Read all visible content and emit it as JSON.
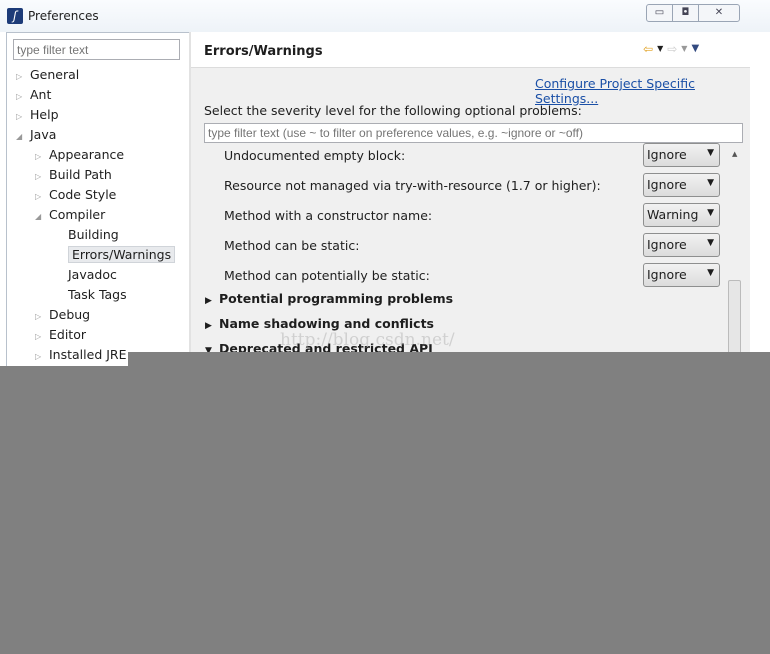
{
  "window": {
    "title": "Preferences",
    "app_icon": "eclipse-icon",
    "controls": [
      "minimize",
      "maximize",
      "close"
    ]
  },
  "sidebar": {
    "filter_placeholder": "type filter text",
    "items": [
      {
        "label": "General",
        "level": 0,
        "state": "collapsed"
      },
      {
        "label": "Ant",
        "level": 0,
        "state": "collapsed"
      },
      {
        "label": "Help",
        "level": 0,
        "state": "collapsed"
      },
      {
        "label": "Java",
        "level": 0,
        "state": "expanded"
      },
      {
        "label": "Appearance",
        "level": 1,
        "state": "collapsed"
      },
      {
        "label": "Build Path",
        "level": 1,
        "state": "collapsed"
      },
      {
        "label": "Code Style",
        "level": 1,
        "state": "collapsed"
      },
      {
        "label": "Compiler",
        "level": 1,
        "state": "expanded"
      },
      {
        "label": "Building",
        "level": 2,
        "state": "leaf"
      },
      {
        "label": "Errors/Warnings",
        "level": 2,
        "state": "leaf",
        "selected": true
      },
      {
        "label": "Javadoc",
        "level": 2,
        "state": "leaf"
      },
      {
        "label": "Task Tags",
        "level": 2,
        "state": "leaf"
      },
      {
        "label": "Debug",
        "level": 1,
        "state": "collapsed"
      },
      {
        "label": "Editor",
        "level": 1,
        "state": "collapsed"
      },
      {
        "label": "Installed JRE",
        "level": 1,
        "state": "collapsed"
      }
    ]
  },
  "main": {
    "title": "Errors/Warnings",
    "nav_icons": [
      "back-arrow-icon",
      "forward-arrow-icon",
      "view-menu-icon"
    ],
    "configure_link": "Configure Project Specific Settings...",
    "instruction": "Select the severity level for the following optional problems:",
    "filter_placeholder": "type filter text (use ~ to filter on preference values, e.g. ~ignore or ~off)",
    "options": [
      {
        "label": "Undocumented empty block:",
        "value": "Ignore"
      },
      {
        "label": "Resource not managed via try-with-resource (1.7 or higher):",
        "value": "Ignore"
      },
      {
        "label": "Method with a constructor name:",
        "value": "Warning"
      },
      {
        "label": "Method can be static:",
        "value": "Ignore"
      },
      {
        "label": "Method can potentially be static:",
        "value": "Ignore"
      }
    ],
    "sections": [
      {
        "label": "Potential programming problems",
        "expanded": false
      },
      {
        "label": "Name shadowing and conflicts",
        "expanded": false
      },
      {
        "label": "Deprecated and restricted API",
        "expanded": true
      }
    ]
  },
  "watermark": "http://blog.csdn.net/"
}
